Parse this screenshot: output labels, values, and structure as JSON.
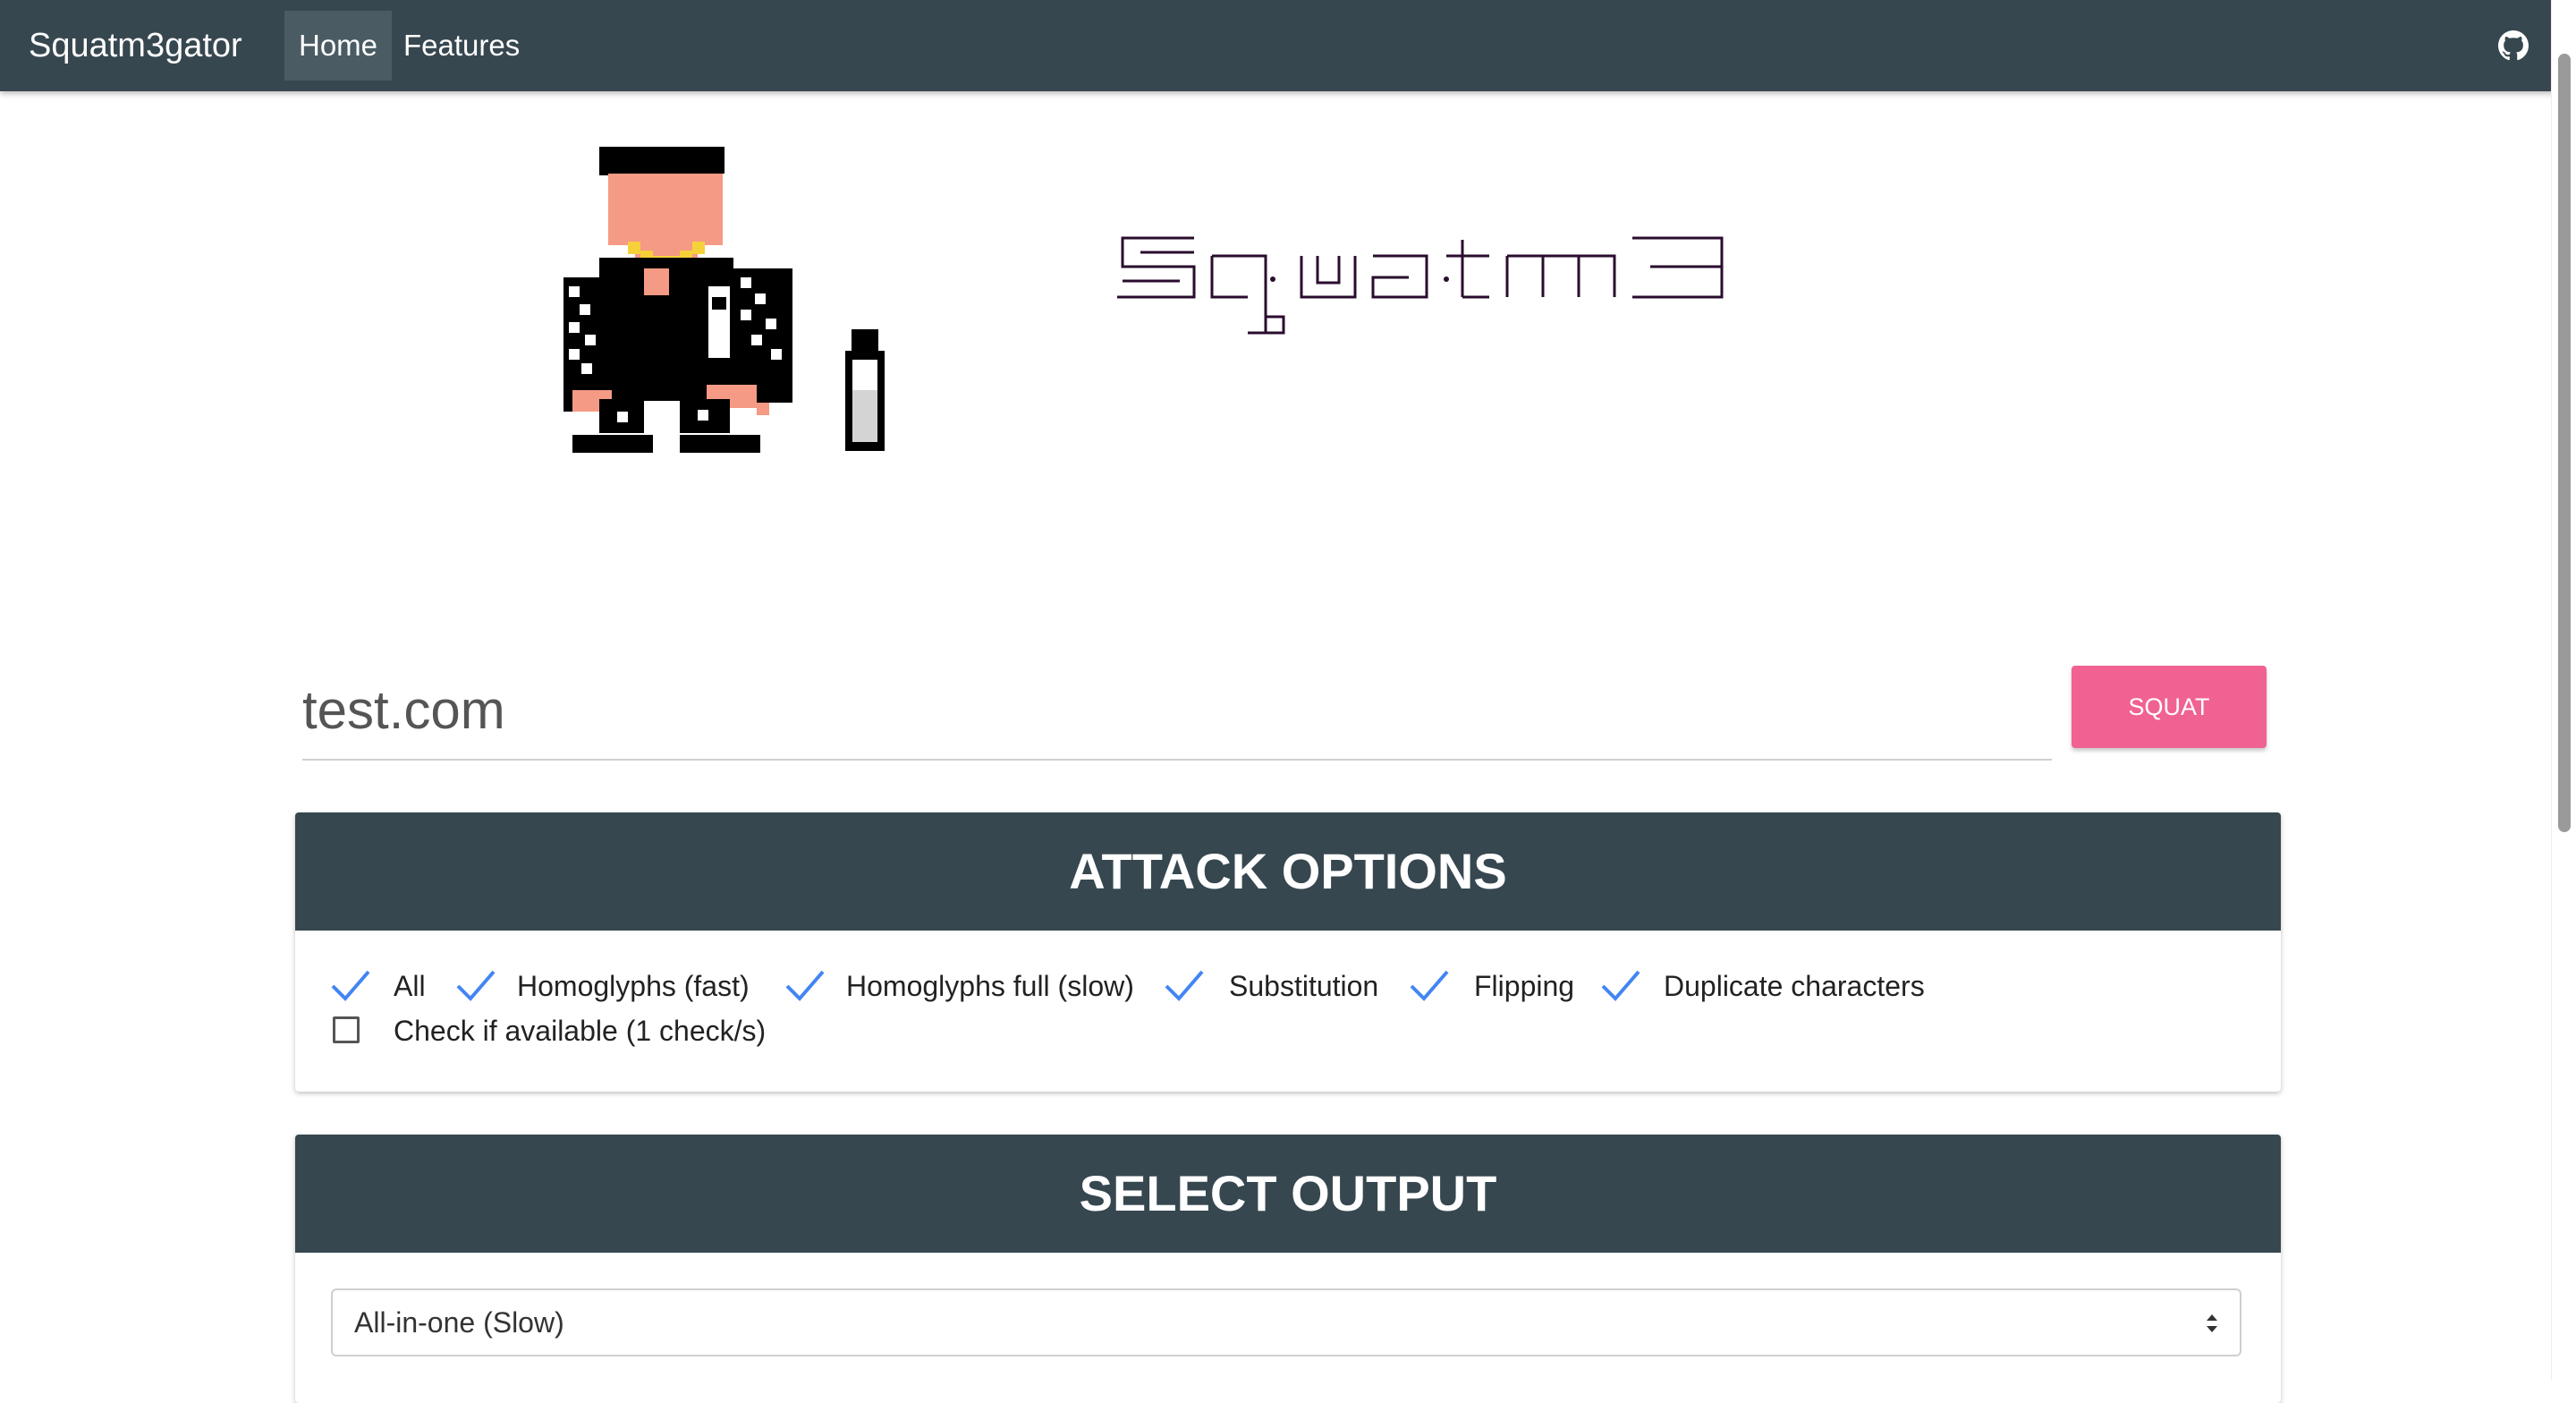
{
  "nav": {
    "brand": "Squatm3gator",
    "items": [
      {
        "label": "Home",
        "active": true
      },
      {
        "label": "Features",
        "active": false
      }
    ],
    "github_icon": "github-icon"
  },
  "hero": {
    "mascot": "pixel-art-squatting-man",
    "ascii_logo_text": "Squatm3"
  },
  "search": {
    "value": "test.com",
    "button_label": "SQUAT"
  },
  "attack_options": {
    "title": "ATTACK OPTIONS",
    "options": [
      {
        "label": "All",
        "checked": true
      },
      {
        "label": "Homoglyphs (fast)",
        "checked": true
      },
      {
        "label": "Homoglyphs full (slow)",
        "checked": true
      },
      {
        "label": "Substitution",
        "checked": true
      },
      {
        "label": "Flipping",
        "checked": true
      },
      {
        "label": "Duplicate characters",
        "checked": true
      },
      {
        "label": "Check if available (1 check/s)",
        "checked": false
      }
    ]
  },
  "output": {
    "title": "SELECT OUTPUT",
    "selected": "All-in-one (Slow)"
  },
  "colors": {
    "navbar": "#37474f",
    "accent": "#f06292",
    "check": "#4285f4"
  }
}
